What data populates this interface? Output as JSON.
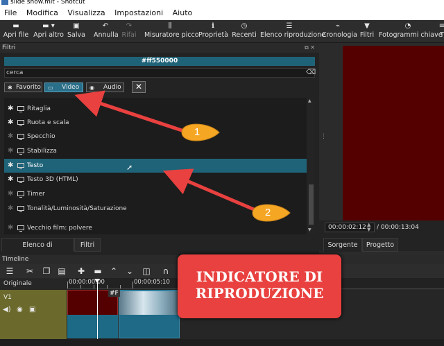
{
  "window": {
    "title": "slide show.mlt - Shotcut"
  },
  "menu": [
    "File",
    "Modifica",
    "Visualizza",
    "Impostazioni",
    "Aiuto"
  ],
  "toolbar": {
    "items": [
      {
        "icon": "open-file-icon",
        "label": "Apri file"
      },
      {
        "icon": "open-other-icon",
        "label": "Apri altro"
      },
      {
        "icon": "save-icon",
        "label": "Salva"
      },
      {
        "icon": "undo-icon",
        "label": "Annulla"
      },
      {
        "icon": "redo-icon",
        "label": "Rifai"
      },
      {
        "icon": "peak-meter-icon",
        "label": "Misuratore picco"
      },
      {
        "icon": "properties-icon",
        "label": "Proprietà"
      },
      {
        "icon": "recent-icon",
        "label": "Recenti"
      },
      {
        "icon": "playlist-icon",
        "label": "Elenco riproduzione"
      },
      {
        "icon": "history-icon",
        "label": "Cronologia"
      },
      {
        "icon": "filters-icon",
        "label": "Filtri"
      },
      {
        "icon": "keyframes-icon",
        "label": "Fotogrammi chiave"
      },
      {
        "icon": "timeline-icon",
        "label": "T"
      }
    ],
    "disabled": [
      "Rifai"
    ]
  },
  "filters_panel": {
    "title": "Filtri",
    "color_value": "#ff550000",
    "search_placeholder": "cerca",
    "tabs": {
      "favorite": "Favorito",
      "video": "Video",
      "audio": "Audio"
    },
    "selected_tab": "Video",
    "items": [
      {
        "label": "Ritaglia",
        "favorite": true
      },
      {
        "label": "Ruota e scala",
        "favorite": true
      },
      {
        "label": "Specchio",
        "favorite": false
      },
      {
        "label": "Stabilizza",
        "favorite": false
      },
      {
        "label": "Testo",
        "favorite": true,
        "selected": true
      },
      {
        "label": "Testo 3D (HTML)",
        "favorite": true
      },
      {
        "label": "Timer",
        "favorite": false
      },
      {
        "label": "Tonalità/Luminosità/Saturazione",
        "favorite": false
      },
      {
        "label": "Vecchio film: polvere",
        "favorite": false
      }
    ]
  },
  "bottom_tabs": {
    "playlist": "Elenco di riproduzione",
    "filters": "Filtri"
  },
  "viewer": {
    "position": "00:00:02:12",
    "duration": "/ 00:00:13:04",
    "tabs": {
      "source": "Sorgente",
      "project": "Progetto"
    },
    "frame_color": "#550000"
  },
  "timeline": {
    "title": "Timeline",
    "master_label": "Originale",
    "ruler": [
      "00:00:00:00",
      "00:00:05:10"
    ],
    "track": "V1",
    "clip_label": "#F"
  },
  "annotations": {
    "callout": "INDICATORE DI RIPRODUZIONE",
    "badge1": "1",
    "badge2": "2",
    "color": "#e8413f",
    "badge_color": "#f5a623"
  }
}
